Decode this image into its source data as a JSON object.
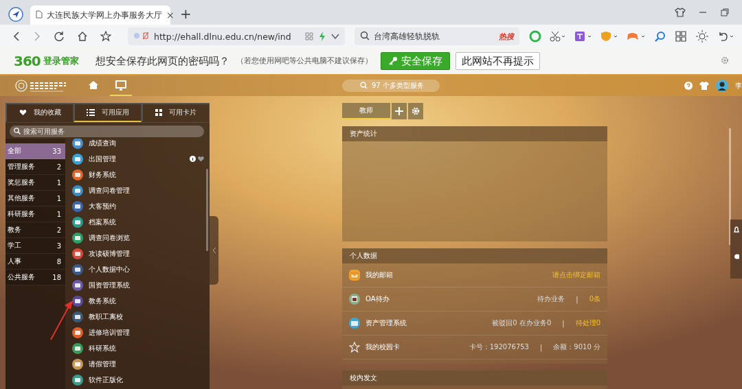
{
  "browser": {
    "tab": {
      "title": "大连民族大学网上办事服务大厅",
      "close": "×"
    },
    "new_tab": "+",
    "address": "http://ehall.dlnu.edu.cn/new/ind",
    "search": "台湾高雄轻轨脱轨",
    "search_badge": "热搜"
  },
  "password_bar": {
    "brand": "360",
    "brand_label": "登录管家",
    "question": "想安全保存此网页的密码吗？",
    "note": "（若您使用网吧等公共电脑不建议保存）",
    "save_button": "安全保存",
    "dismiss_button": "此网站不再提示"
  },
  "header": {
    "nav": [
      {
        "kind": "home",
        "selected": false
      },
      {
        "kind": "desktop",
        "selected": true
      }
    ],
    "search_placeholder": "97 个多类型服务",
    "user_name": "李"
  },
  "panel": {
    "tabs": [
      {
        "label": "我的收藏",
        "kind": "heart",
        "selected": false
      },
      {
        "label": "可用应用",
        "kind": "list",
        "selected": true
      },
      {
        "label": "可用卡片",
        "kind": "grid",
        "selected": false
      }
    ],
    "search_placeholder": "搜索可用服务",
    "categories": [
      {
        "label": "全部",
        "count": "33",
        "selected": true
      },
      {
        "label": "管理服务",
        "count": "2",
        "selected": false
      },
      {
        "label": "奖惩服务",
        "count": "1",
        "selected": false
      },
      {
        "label": "其他服务",
        "count": "1",
        "selected": false
      },
      {
        "label": "科研服务",
        "count": "1",
        "selected": false
      },
      {
        "label": "教务",
        "count": "2",
        "selected": false
      },
      {
        "label": "学工",
        "count": "3",
        "selected": false
      },
      {
        "label": "人事",
        "count": "8",
        "selected": false
      },
      {
        "label": "公共服务",
        "count": "18",
        "selected": false
      }
    ],
    "apps": [
      {
        "label": "成绩查询",
        "color": "#4a8fc8",
        "actions_shown": false
      },
      {
        "label": "出国管理",
        "color": "#3aa0d8",
        "actions_shown": true
      },
      {
        "label": "财务系统",
        "color": "#e0682a",
        "actions_shown": false
      },
      {
        "label": "调查问卷管理",
        "color": "#3a8cc4",
        "actions_shown": false
      },
      {
        "label": "大客预约",
        "color": "#3a68a8",
        "actions_shown": false
      },
      {
        "label": "档案系统",
        "color": "#2a9a8a",
        "actions_shown": false
      },
      {
        "label": "调查问卷浏览",
        "color": "#2aa066",
        "actions_shown": false
      },
      {
        "label": "攻读硕博管理",
        "color": "#d84a3a",
        "actions_shown": false
      },
      {
        "label": "个人数据中心",
        "color": "#3a5a8a",
        "actions_shown": false
      },
      {
        "label": "国资管理系统",
        "color": "#6a5aa8",
        "actions_shown": false
      },
      {
        "label": "教务系统",
        "color": "#5a4a9a",
        "actions_shown": false
      },
      {
        "label": "教职工离校",
        "color": "#3a5a7a",
        "actions_shown": false
      },
      {
        "label": "进修培训管理",
        "color": "#e0602a",
        "actions_shown": false
      },
      {
        "label": "科研系统",
        "color": "#3a9a5a",
        "actions_shown": false
      },
      {
        "label": "请假管理",
        "color": "#c8985a",
        "actions_shown": false
      },
      {
        "label": "软件正版化",
        "color": "#3a9a8a",
        "actions_shown": false
      }
    ]
  },
  "dashboard": {
    "role_tab": {
      "label": "教师",
      "selected": true
    },
    "asset_card": {
      "title": "资产统计"
    },
    "personal_card": {
      "title": "个人数据",
      "rows": [
        {
          "label": "我的邮箱",
          "kind": "mail",
          "parts": [
            {
              "text": "请点击绑定邮箱",
              "highlight": true
            }
          ]
        },
        {
          "label": "OA待办",
          "kind": "oa",
          "parts": [
            {
              "text": "待办业务",
              "highlight": false
            },
            {
              "text": "|",
              "highlight": false
            },
            {
              "text": "0条",
              "highlight": true
            }
          ]
        },
        {
          "label": "资产管理系统",
          "kind": "asset",
          "parts": [
            {
              "text": "被驳回0 在办业务0",
              "highlight": false
            },
            {
              "text": "|",
              "highlight": false
            },
            {
              "text": "待处理0",
              "highlight": true
            }
          ]
        },
        {
          "label": "我的校园卡",
          "kind": "star",
          "parts": [
            {
              "text": "卡号：192076753",
              "highlight": false
            },
            {
              "text": "|",
              "highlight": false
            },
            {
              "text": "余额：9010 分",
              "highlight": false
            }
          ]
        }
      ]
    },
    "news_card": {
      "title": "校内发文"
    }
  }
}
